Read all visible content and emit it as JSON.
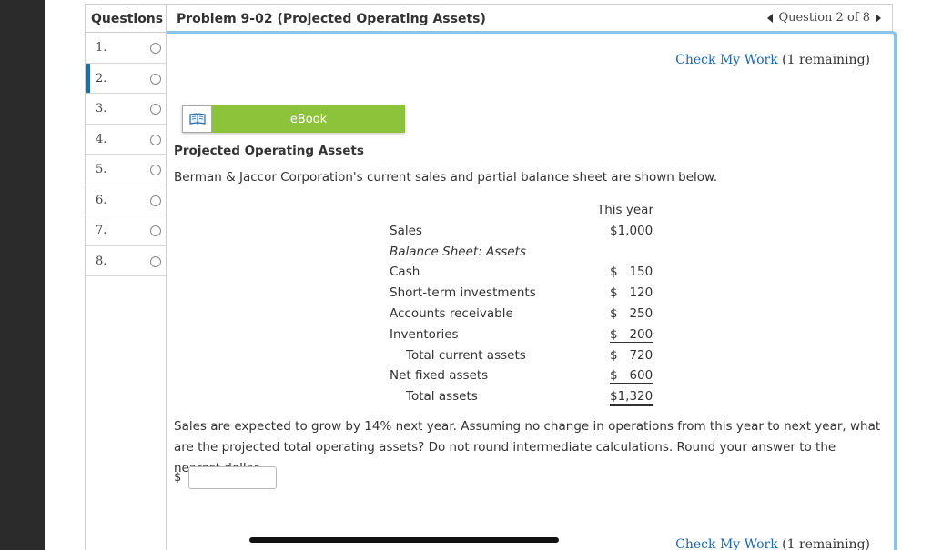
{
  "sidebar": {
    "header": "Questions",
    "items": [
      {
        "label": "1."
      },
      {
        "label": "2."
      },
      {
        "label": "3."
      },
      {
        "label": "4."
      },
      {
        "label": "5."
      },
      {
        "label": "6."
      },
      {
        "label": "7."
      },
      {
        "label": "8."
      }
    ],
    "active_index": 1
  },
  "header": {
    "title": "Problem 9-02 (Projected Operating Assets)",
    "nav_text": "Question 2 of 8"
  },
  "check_my_work": {
    "link": "Check My Work",
    "remaining": "(1 remaining)"
  },
  "ebook": {
    "label": "eBook",
    "icon": "book-icon"
  },
  "problem": {
    "section_title": "Projected Operating Assets",
    "intro": "Berman & Jaccor Corporation's current sales and partial balance sheet are shown below.",
    "column_header": "This year",
    "rows": [
      {
        "label": "Sales",
        "value": "$1,000"
      },
      {
        "label": "Balance Sheet: Assets",
        "value": ""
      },
      {
        "label": "Cash",
        "value": "$   150"
      },
      {
        "label": "Short-term investments",
        "value": "$   120"
      },
      {
        "label": "Accounts receivable",
        "value": "$   250"
      },
      {
        "label": "Inventories",
        "value": "$   200"
      },
      {
        "label": "Total current assets",
        "value": "$   720"
      },
      {
        "label": "Net fixed assets",
        "value": "$   600"
      },
      {
        "label": "Total assets",
        "value": "$1,320"
      }
    ],
    "question": "Sales are expected to grow by 14% next year. Assuming no change in operations from this year to next year, what are the projected total operating assets? Do not round intermediate calculations. Round your answer to the nearest dollar.",
    "answer_prefix": "$",
    "answer_value": ""
  },
  "colors": {
    "accent_blue": "#8cc3ec",
    "link_blue": "#1c67a8",
    "ebook_green": "#8dc33b",
    "active_marker": "#1f6fa6"
  }
}
